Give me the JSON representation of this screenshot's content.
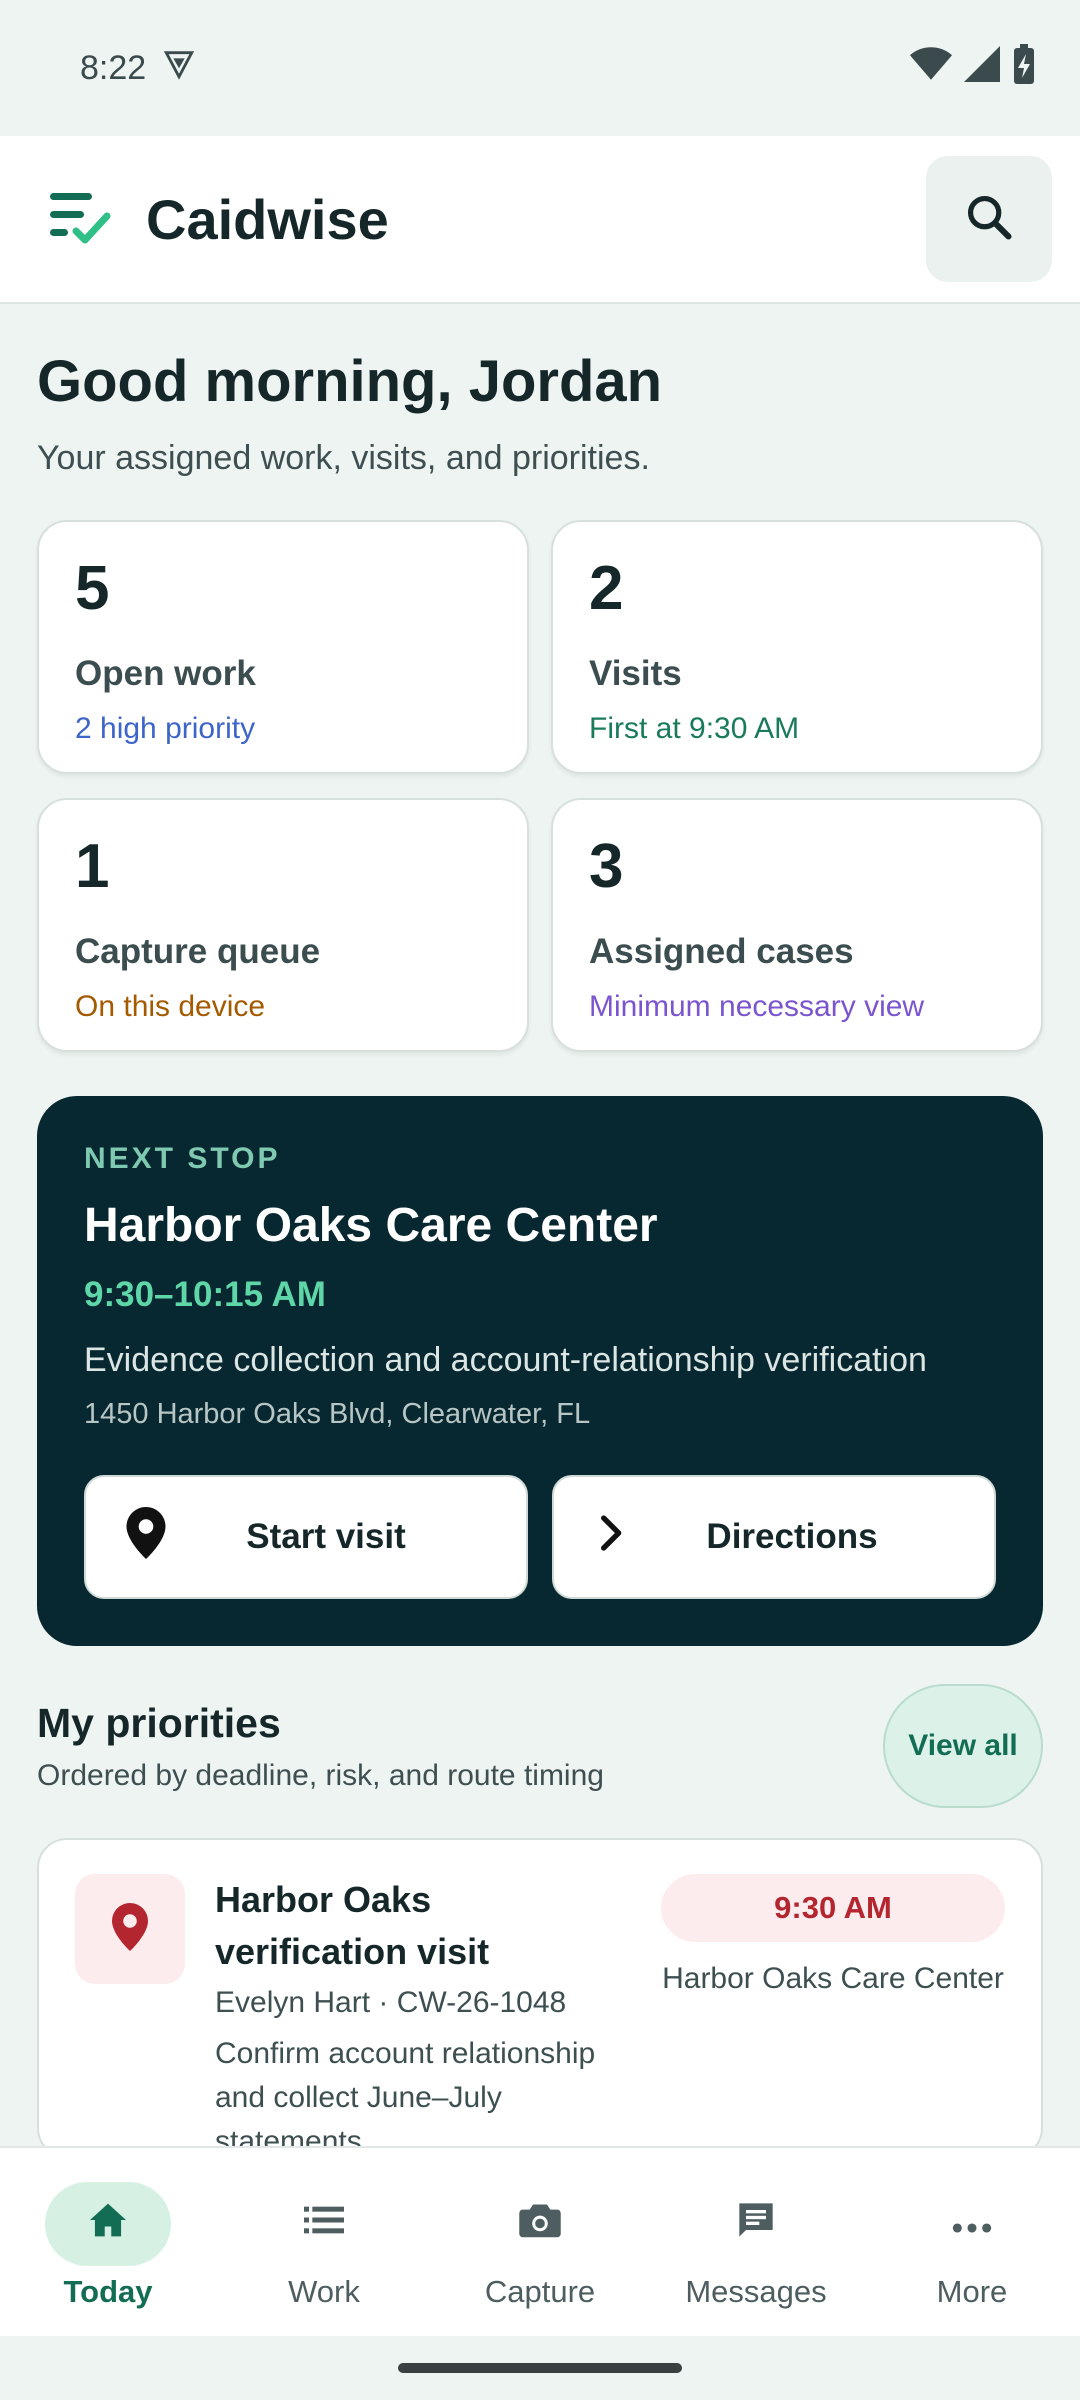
{
  "status_bar": {
    "time": "8:22"
  },
  "app": {
    "name": "Caidwise"
  },
  "greeting": {
    "title": "Good morning, Jordan",
    "subtitle": "Your assigned work, visits, and priorities."
  },
  "stats": [
    {
      "value": "5",
      "label": "Open work",
      "sub": "2 high priority",
      "color": "#3d64c8"
    },
    {
      "value": "2",
      "label": "Visits",
      "sub": "First at 9:30 AM",
      "color": "#1a7a5c"
    },
    {
      "value": "1",
      "label": "Capture queue",
      "sub": "On this device",
      "color": "#a55a00"
    },
    {
      "value": "3",
      "label": "Assigned cases",
      "sub": "Minimum necessary view",
      "color": "#7b55d0"
    }
  ],
  "next_stop": {
    "eyebrow": "NEXT STOP",
    "title": "Harbor Oaks Care Center",
    "time": "9:30–10:15 AM",
    "description": "Evidence collection and account-relationship verification",
    "address": "1450 Harbor Oaks Blvd, Clearwater, FL",
    "start_label": "Start visit",
    "directions_label": "Directions"
  },
  "priorities": {
    "title": "My priorities",
    "subtitle": "Ordered by deadline, risk, and route timing",
    "view_all_label": "View all",
    "items": [
      {
        "title": "Harbor Oaks verification visit",
        "meta": "Evelyn Hart · CW-26-1048",
        "description": "Confirm account relationship and collect June–July statements",
        "time": "9:30 AM",
        "place": "Harbor Oaks Care Center",
        "icon": "location-pin-icon"
      }
    ]
  },
  "nav": {
    "items": [
      {
        "label": "Today",
        "icon": "home-icon",
        "active": true
      },
      {
        "label": "Work",
        "icon": "list-icon",
        "active": false
      },
      {
        "label": "Capture",
        "icon": "camera-icon",
        "active": false
      },
      {
        "label": "Messages",
        "icon": "message-icon",
        "active": false
      },
      {
        "label": "More",
        "icon": "more-icon",
        "active": false
      }
    ]
  },
  "colors": {
    "accent": "#136d55",
    "dark_card": "#072830",
    "alert": "#b3262f"
  }
}
